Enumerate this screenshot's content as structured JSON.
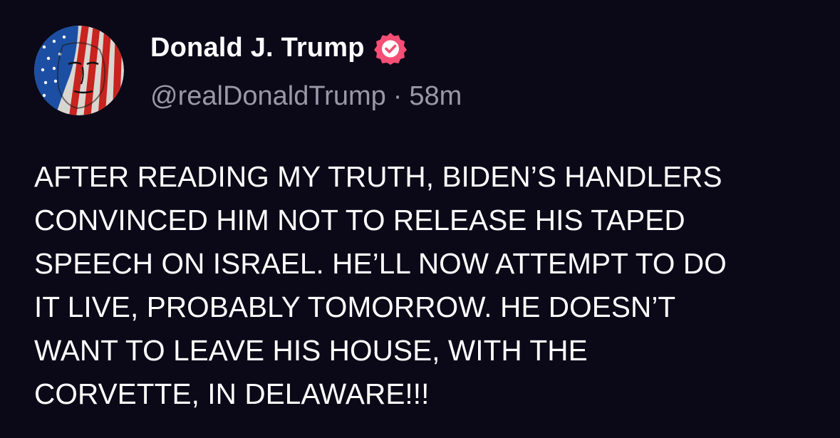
{
  "post": {
    "author": {
      "display_name": "Donald J. Trump",
      "handle": "@realDonaldTrump",
      "avatar": "avatar-image",
      "verified_icon": "verified-badge-icon"
    },
    "separator": "·",
    "timestamp": "58m",
    "body": "AFTER READING MY TRUTH, BIDEN’S HANDLERS\nCONVINCED HIM NOT TO RELEASE HIS TAPED\nSPEECH ON ISRAEL. HE’LL NOW ATTEMPT TO DO\nIT LIVE, PROBABLY TOMORROW. HE DOESN’T\nWANT TO LEAVE HIS HOUSE, WITH THE\nCORVETTE, IN DELAWARE!!!"
  },
  "colors": {
    "background": "#0b0918",
    "text_primary": "#ffffff",
    "text_secondary": "#9a98a6",
    "verified_badge": "#f54f75"
  }
}
